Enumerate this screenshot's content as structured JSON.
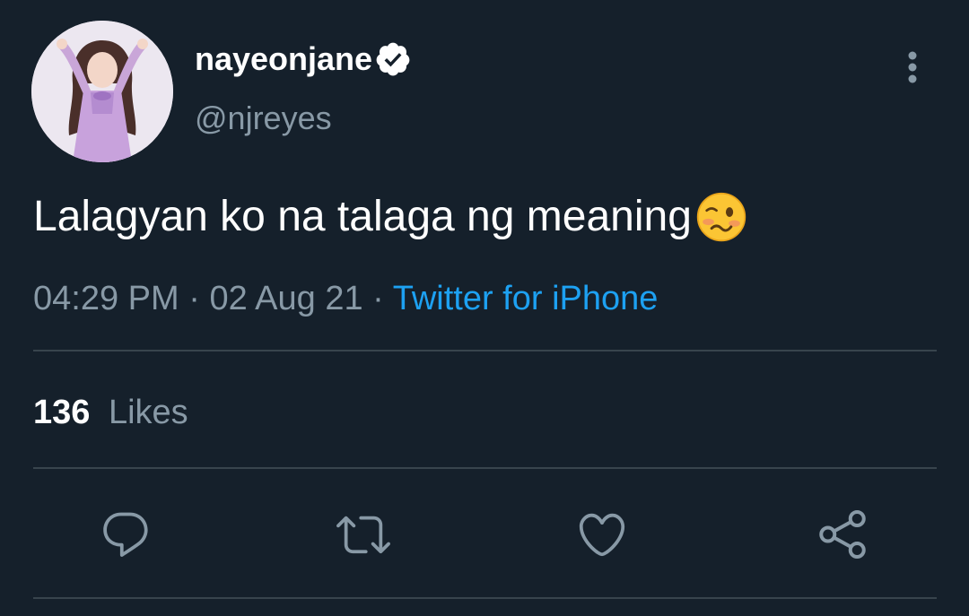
{
  "tweet": {
    "author": {
      "display_name": "nayeonjane",
      "handle": "@njreyes",
      "verified": true,
      "avatar_icon": "profile-photo"
    },
    "text": "Lalagyan ko na talaga ng meaning",
    "emoji": "woozy-face",
    "time": "04:29 PM",
    "date": "02 Aug 21",
    "dot": "·",
    "source": "Twitter for iPhone",
    "likes": {
      "count": "136",
      "label": "Likes"
    }
  },
  "actions": [
    {
      "name": "reply",
      "icon": "speech-bubble-icon"
    },
    {
      "name": "retweet",
      "icon": "retweet-icon"
    },
    {
      "name": "like",
      "icon": "heart-icon"
    },
    {
      "name": "share",
      "icon": "share-icon"
    }
  ],
  "colors": {
    "background": "#15202b",
    "text_primary": "#ffffff",
    "text_secondary": "#8899a6",
    "link": "#1da1f2",
    "divider": "#38444d"
  }
}
